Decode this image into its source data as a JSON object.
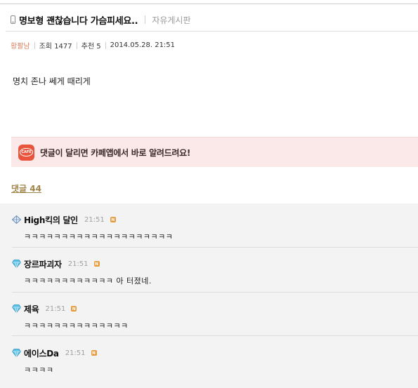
{
  "post": {
    "title": "명보형 괜찮습니다 가슴피세요..",
    "board": "자유게시판",
    "author": "황팔남",
    "views_label": "조회 1477",
    "recommend_label": "추천 5",
    "date": "2014.05.28. 21:51",
    "body": "명치 존나 쎄게 때리게"
  },
  "banner": {
    "text": "댓글이 달리면 카페앱에서 바로 알려드려요!",
    "icon_text": "CAFE"
  },
  "comments_header": {
    "label": "댓글 44"
  },
  "comments": [
    {
      "name": "High킥의 달인",
      "time": "21:51",
      "text": "ㅋㅋㅋㅋㅋㅋㅋㅋㅋㅋㅋㅋㅋㅋㅋㅋㅋㅋㅋㅋ",
      "icon": "diamond-outline-icon"
    },
    {
      "name": "장르파괴자",
      "time": "21:51",
      "text": "ㅋㅋㅋㅋㅋㅋㅋㅋㅋㅋㅋㅋ 아 터졌네.",
      "icon": "diamond-gem-icon"
    },
    {
      "name": "제육",
      "time": "21:51",
      "text": "ㅋㅋㅋㅋㅋㅋㅋㅋㅋㅋㅋㅋㅋㅋ",
      "icon": "diamond-gem-icon"
    },
    {
      "name": "에이스Da",
      "time": "21:51",
      "text": "ㅋㅋㅋㅋ",
      "icon": "diamond-gem-icon"
    }
  ],
  "badge_letter": "N",
  "colors": {
    "author": "#d97f5e",
    "comment_count": "#a0864a",
    "banner_bg": "#fbe8e8",
    "comments_bg": "#f3f3f3",
    "cafe_icon": "#e8553c",
    "new_badge": "#e49a3b"
  }
}
